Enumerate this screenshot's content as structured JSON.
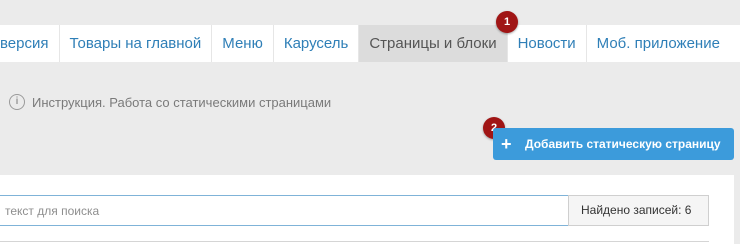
{
  "tabs": [
    {
      "label": "версия",
      "active": false
    },
    {
      "label": "Товары на главной",
      "active": false
    },
    {
      "label": "Меню",
      "active": false
    },
    {
      "label": "Карусель",
      "active": false
    },
    {
      "label": "Страницы и блоки",
      "active": true
    },
    {
      "label": "Новости",
      "active": false
    },
    {
      "label": "Моб. приложение",
      "active": false
    }
  ],
  "badges": {
    "first": "1",
    "second": "2"
  },
  "instruction": {
    "icon": "info-icon",
    "text": "Инструкция. Работа со статическими страницами"
  },
  "add_button": {
    "icon": "plus-icon",
    "symbol": "+",
    "label": "Добавить статическую страницу"
  },
  "search": {
    "placeholder": "текст для поиска",
    "value": ""
  },
  "records": {
    "label": "Найдено записей: 6"
  },
  "colors": {
    "accent": "#3c9bdb",
    "badge": "#a01515",
    "tab_link": "#2f7fb7",
    "active_tab_bg": "#dcdcdc",
    "page_bg": "#ebebeb"
  }
}
